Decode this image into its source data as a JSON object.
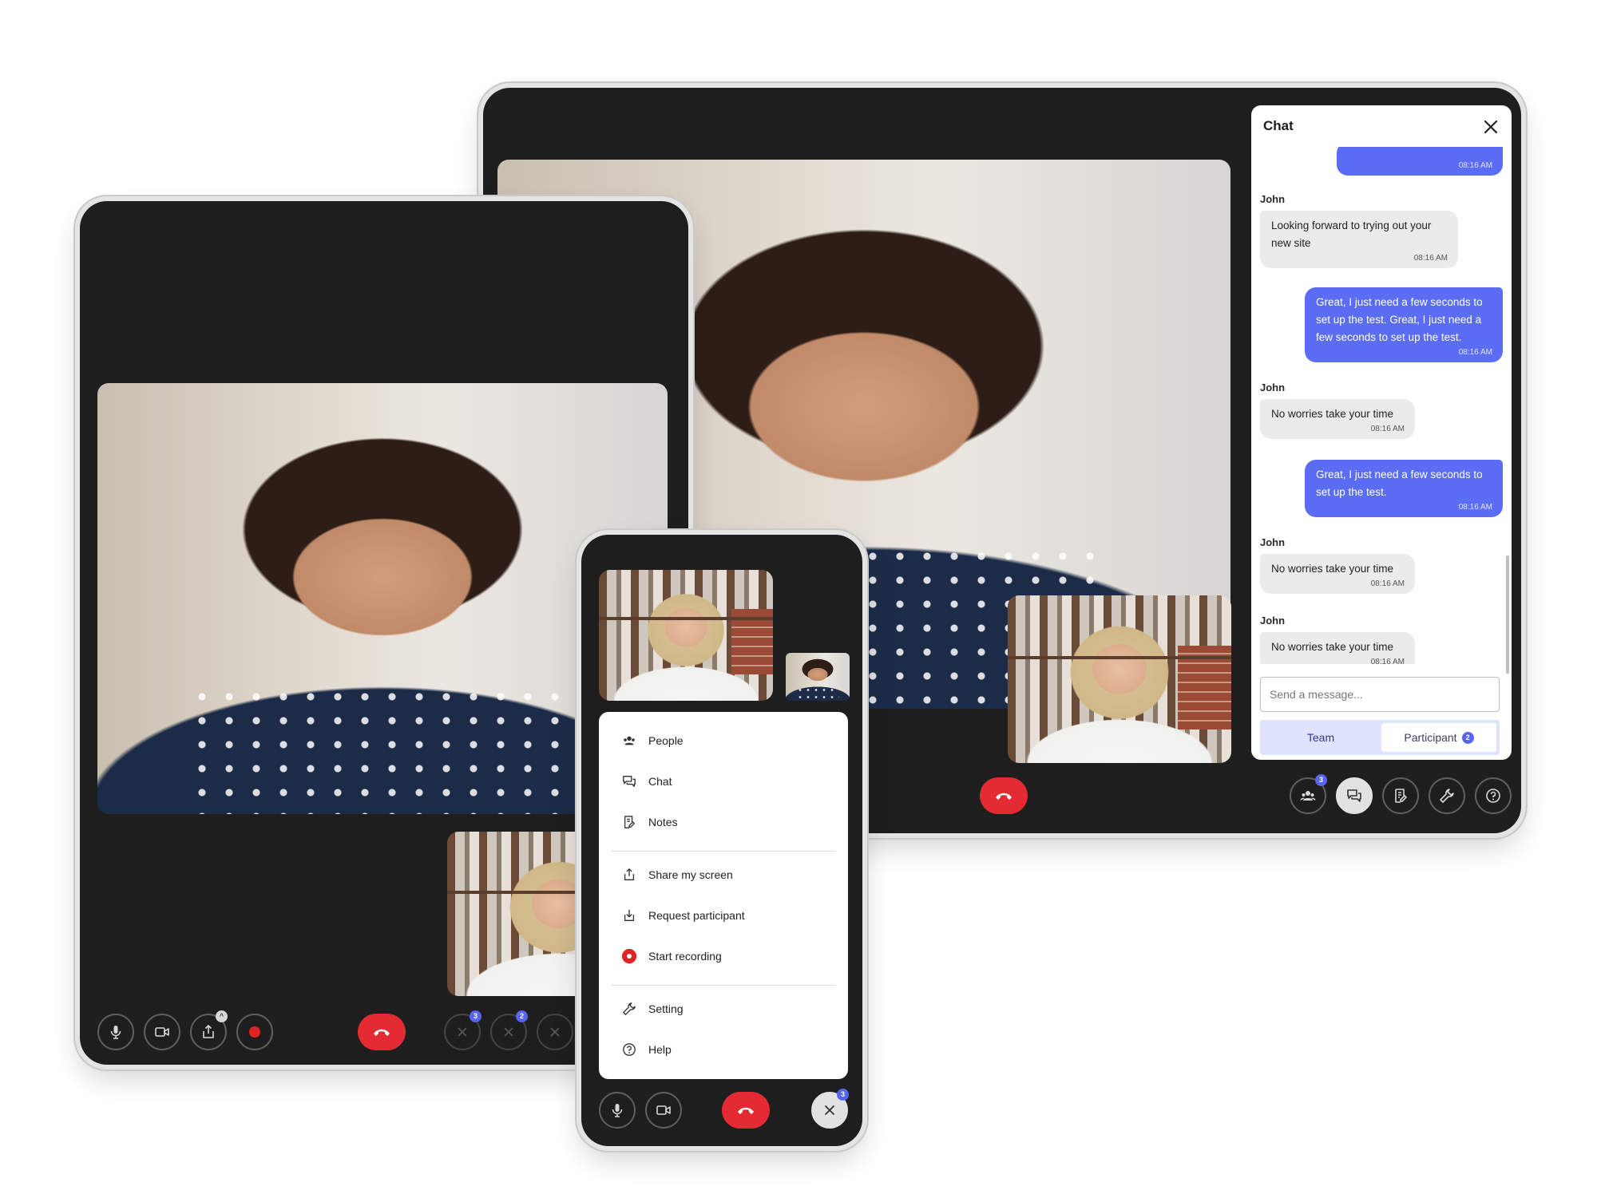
{
  "chat": {
    "title": "Chat",
    "messages": [
      {
        "direction": "out",
        "text": "",
        "time": "08:16 AM"
      },
      {
        "sender": "John",
        "direction": "in",
        "text": "Looking forward to trying out your new site",
        "time": "08:16 AM"
      },
      {
        "direction": "out",
        "text": "Great, I just need a few seconds to set up the test. Great, I just need a few seconds to set up the test.",
        "time": "08:16 AM"
      },
      {
        "sender": "John",
        "direction": "in",
        "text": "No worries take your time",
        "time": "08:16 AM"
      },
      {
        "direction": "out",
        "text": "Great, I just need a few seconds to set up the test.",
        "time": "08:16 AM"
      },
      {
        "sender": "John",
        "direction": "in",
        "text": "No worries take your time",
        "time": "08:16 AM"
      },
      {
        "sender": "John",
        "direction": "in",
        "text": "No worries take your time",
        "time": "08:16 AM"
      }
    ],
    "input_placeholder": "Send a message...",
    "tabs": {
      "team": "Team",
      "participant": "Participant",
      "participant_count": "2"
    }
  },
  "large_device": {
    "toolbar_badges": {
      "people": "3"
    }
  },
  "left_device": {
    "toolbar_badges": {
      "share": "^",
      "first": "3",
      "second": "2"
    }
  },
  "phone": {
    "menu": {
      "people": "People",
      "chat": "Chat",
      "notes": "Notes",
      "share": "Share my screen",
      "request": "Request participant",
      "record": "Start recording",
      "setting": "Setting",
      "help": "Help"
    },
    "close_badge": "3"
  },
  "colors": {
    "accent": "#5b6df4",
    "end_call": "#e42b33",
    "record": "#e02424",
    "device_bg": "#1e1e1e"
  }
}
